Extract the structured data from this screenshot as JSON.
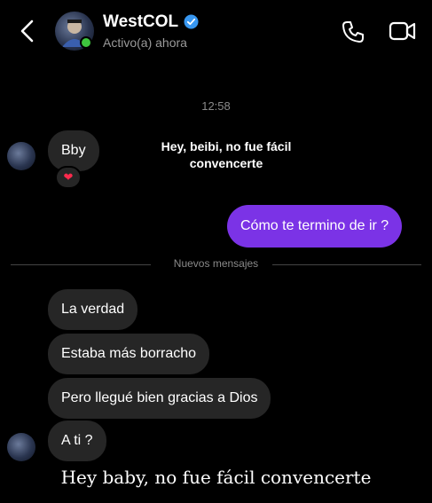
{
  "header": {
    "contact_name": "WestCOL",
    "status": "Activo(a) ahora"
  },
  "chat": {
    "timestamp": "12:58",
    "messages": [
      {
        "text": "Bby",
        "direction": "in"
      },
      {
        "text": "Cómo te termino de ir ?",
        "direction": "out"
      },
      {
        "text": "La verdad",
        "direction": "in"
      },
      {
        "text": "Estaba más borracho",
        "direction": "in"
      },
      {
        "text": "Pero llegué bien gracias a Dios",
        "direction": "in"
      },
      {
        "text": "A ti ?",
        "direction": "in"
      }
    ],
    "reaction": "❤",
    "divider_label": "Nuevos mensajes"
  },
  "overlays": {
    "caption_top": "Hey, beibi, no fue fácil convencerte",
    "subtitle": "Hey baby, no fue fácil convencerte"
  },
  "colors": {
    "background": "#000000",
    "incoming_bubble": "#262626",
    "outgoing_bubble": "#7b33e6",
    "online_indicator": "#3ec53e",
    "verified_badge": "#3897f0"
  },
  "icons": [
    "chevron-left-icon",
    "verified-icon",
    "phone-icon",
    "video-camera-icon",
    "heart-icon"
  ]
}
